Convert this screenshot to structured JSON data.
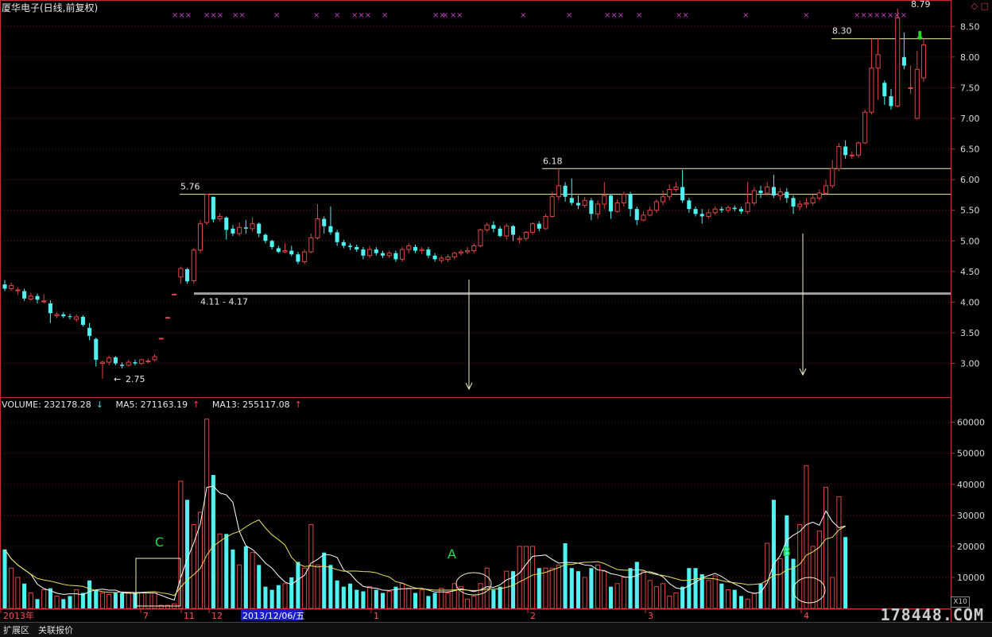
{
  "title": "厦华电子(日线,前复权)",
  "window_icons": "◇ □",
  "colors": {
    "up": "#e04545",
    "down": "#4ff1f1",
    "axis": "#c03030",
    "ma5": "#ffffff",
    "ma13": "#e8e060",
    "grid": "#661818",
    "mark": "#c040c0",
    "hline": "#f0f0b0",
    "support": "#a0a0a0"
  },
  "chart_data": [
    {
      "type": "candlestick",
      "title": "厦华电子(日线,前复权)",
      "ylim": [
        2.45,
        8.75
      ],
      "y_ticks": [
        "8.50",
        "8.00",
        "7.50",
        "7.00",
        "6.50",
        "6.00",
        "5.50",
        "5.00",
        "4.50",
        "4.00",
        "3.50",
        "3.00"
      ],
      "annotations": {
        "low_label": "2.75",
        "range_label": "4.11 - 4.17",
        "level_576": "5.76",
        "level_618": "6.18",
        "level_830": "8.30",
        "high_label": "8.79"
      },
      "reference_levels": [
        5.76,
        6.18,
        8.3,
        4.14
      ],
      "candles": [
        [
          4.29,
          4.22,
          4.36,
          4.18
        ],
        [
          4.22,
          4.27,
          4.32,
          4.18
        ],
        [
          4.2,
          4.2,
          4.24,
          4.12
        ],
        [
          4.18,
          4.06,
          4.22,
          4.02
        ],
        [
          4.05,
          4.1,
          4.15,
          4.02
        ],
        [
          4.1,
          4.04,
          4.14,
          3.98
        ],
        [
          4.02,
          4.02,
          4.13,
          3.98
        ],
        [
          3.98,
          3.82,
          4.03,
          3.66
        ],
        [
          3.78,
          3.8,
          3.84,
          3.74
        ],
        [
          3.8,
          3.77,
          3.84,
          3.74
        ],
        [
          3.77,
          3.76,
          3.81,
          3.72
        ],
        [
          3.72,
          3.76,
          3.8,
          3.68
        ],
        [
          3.76,
          3.63,
          3.79,
          3.6
        ],
        [
          3.58,
          3.45,
          3.66,
          3.38
        ],
        [
          3.4,
          3.06,
          3.42,
          2.95
        ],
        [
          3.0,
          3.02,
          3.05,
          2.75
        ],
        [
          3.02,
          3.09,
          3.13,
          2.97
        ],
        [
          3.1,
          3.0,
          3.12,
          2.97
        ],
        [
          2.98,
          2.96,
          3.02,
          2.92
        ],
        [
          2.97,
          3.02,
          3.06,
          2.95
        ],
        [
          3.02,
          3.0,
          3.06,
          2.97
        ],
        [
          3.0,
          3.06,
          3.08,
          2.98
        ],
        [
          3.04,
          3.04,
          3.08,
          3.0
        ],
        [
          3.06,
          3.11,
          3.15,
          3.03
        ],
        [
          3.41,
          3.41,
          3.42,
          3.4
        ],
        [
          3.75,
          3.75,
          3.76,
          3.74
        ],
        [
          4.13,
          4.13,
          4.14,
          4.12
        ],
        [
          4.41,
          4.55,
          4.58,
          4.3
        ],
        [
          4.54,
          4.34,
          4.56,
          4.3
        ],
        [
          4.35,
          4.85,
          4.88,
          4.3
        ],
        [
          4.85,
          5.28,
          5.34,
          4.8
        ],
        [
          5.3,
          5.76,
          5.76,
          5.26
        ],
        [
          5.72,
          5.35,
          5.72,
          5.3
        ],
        [
          5.36,
          5.4,
          5.45,
          5.32
        ],
        [
          5.38,
          5.18,
          5.4,
          5.02
        ],
        [
          5.2,
          5.12,
          5.26,
          5.08
        ],
        [
          5.12,
          5.22,
          5.3,
          5.08
        ],
        [
          5.22,
          5.2,
          5.34,
          5.12
        ],
        [
          5.2,
          5.28,
          5.38,
          5.16
        ],
        [
          5.28,
          5.12,
          5.3,
          5.06
        ],
        [
          5.1,
          5.0,
          5.12,
          4.96
        ],
        [
          5.0,
          4.9,
          5.02,
          4.86
        ],
        [
          4.88,
          4.82,
          4.92,
          4.8
        ],
        [
          4.82,
          4.84,
          4.96,
          4.8
        ],
        [
          4.84,
          4.78,
          4.92,
          4.75
        ],
        [
          4.78,
          4.66,
          4.82,
          4.62
        ],
        [
          4.66,
          4.82,
          4.86,
          4.62
        ],
        [
          4.82,
          5.05,
          5.12,
          4.8
        ],
        [
          5.05,
          5.36,
          5.6,
          5.02
        ],
        [
          5.36,
          5.24,
          5.4,
          5.12
        ],
        [
          5.24,
          5.14,
          5.56,
          5.1
        ],
        [
          5.14,
          4.98,
          5.18,
          4.92
        ],
        [
          4.98,
          4.92,
          5.02,
          4.88
        ],
        [
          4.92,
          4.9,
          4.96,
          4.85
        ],
        [
          4.9,
          4.86,
          4.94,
          4.82
        ],
        [
          4.86,
          4.76,
          4.9,
          4.7
        ],
        [
          4.76,
          4.86,
          4.92,
          4.72
        ],
        [
          4.86,
          4.8,
          4.9,
          4.76
        ],
        [
          4.8,
          4.76,
          4.84,
          4.72
        ],
        [
          4.76,
          4.8,
          4.84,
          4.72
        ],
        [
          4.8,
          4.7,
          4.84,
          4.66
        ],
        [
          4.7,
          4.86,
          4.9,
          4.66
        ],
        [
          4.86,
          4.92,
          4.96,
          4.8
        ],
        [
          4.9,
          4.84,
          4.94,
          4.8
        ],
        [
          4.84,
          4.86,
          4.9,
          4.78
        ],
        [
          4.86,
          4.76,
          4.9,
          4.72
        ],
        [
          4.76,
          4.7,
          4.8,
          4.66
        ],
        [
          4.68,
          4.72,
          4.76,
          4.64
        ],
        [
          4.7,
          4.74,
          4.78,
          4.66
        ],
        [
          4.74,
          4.8,
          4.82,
          4.7
        ],
        [
          4.8,
          4.82,
          4.86,
          4.76
        ],
        [
          4.82,
          4.84,
          4.9,
          4.78
        ],
        [
          4.84,
          4.92,
          4.96,
          4.8
        ],
        [
          4.92,
          5.18,
          5.2,
          4.9
        ],
        [
          5.18,
          5.26,
          5.3,
          5.14
        ],
        [
          5.26,
          5.2,
          5.32,
          5.14
        ],
        [
          5.2,
          5.08,
          5.24,
          5.06
        ],
        [
          5.08,
          5.24,
          5.28,
          5.02
        ],
        [
          5.24,
          5.1,
          5.26,
          5.0
        ],
        [
          5.02,
          5.04,
          5.08,
          4.96
        ],
        [
          5.04,
          5.14,
          5.16,
          5.0
        ],
        [
          5.14,
          5.28,
          5.3,
          5.1
        ],
        [
          5.28,
          5.2,
          5.32,
          5.16
        ],
        [
          5.2,
          5.4,
          5.44,
          5.18
        ],
        [
          5.4,
          5.72,
          5.8,
          5.38
        ],
        [
          5.72,
          5.9,
          6.18,
          5.66
        ],
        [
          5.9,
          5.72,
          5.96,
          5.64
        ],
        [
          5.7,
          5.62,
          6.02,
          5.58
        ],
        [
          5.62,
          5.58,
          5.74,
          5.52
        ],
        [
          5.58,
          5.66,
          5.72,
          5.54
        ],
        [
          5.66,
          5.44,
          5.7,
          5.34
        ],
        [
          5.44,
          5.6,
          5.66,
          5.36
        ],
        [
          5.6,
          5.74,
          5.96,
          5.52
        ],
        [
          5.74,
          5.48,
          5.76,
          5.36
        ],
        [
          5.48,
          5.62,
          5.68,
          5.46
        ],
        [
          5.62,
          5.76,
          5.8,
          5.56
        ],
        [
          5.76,
          5.52,
          5.8,
          5.4
        ],
        [
          5.52,
          5.34,
          5.56,
          5.26
        ],
        [
          5.34,
          5.42,
          5.48,
          5.32
        ],
        [
          5.42,
          5.5,
          5.56,
          5.4
        ],
        [
          5.5,
          5.64,
          5.68,
          5.46
        ],
        [
          5.64,
          5.72,
          5.82,
          5.58
        ],
        [
          5.72,
          5.84,
          5.92,
          5.66
        ],
        [
          5.84,
          5.88,
          5.96,
          5.8
        ],
        [
          5.88,
          5.66,
          6.16,
          5.62
        ],
        [
          5.66,
          5.52,
          5.7,
          5.46
        ],
        [
          5.52,
          5.44,
          5.56,
          5.4
        ],
        [
          5.44,
          5.4,
          5.52,
          5.28
        ],
        [
          5.4,
          5.46,
          5.52,
          5.36
        ],
        [
          5.46,
          5.52,
          5.56,
          5.42
        ],
        [
          5.52,
          5.5,
          5.56,
          5.46
        ],
        [
          5.5,
          5.54,
          5.58,
          5.46
        ],
        [
          5.54,
          5.52,
          5.58,
          5.48
        ],
        [
          5.52,
          5.48,
          5.56,
          5.44
        ],
        [
          5.48,
          5.62,
          5.96,
          5.44
        ],
        [
          5.62,
          5.82,
          5.88,
          5.58
        ],
        [
          5.82,
          5.78,
          5.9,
          5.7
        ],
        [
          5.78,
          5.88,
          5.96,
          5.74
        ],
        [
          5.88,
          5.74,
          6.08,
          5.7
        ],
        [
          5.74,
          5.8,
          5.86,
          5.66
        ],
        [
          5.8,
          5.7,
          5.86,
          5.62
        ],
        [
          5.7,
          5.56,
          5.74,
          5.44
        ],
        [
          5.56,
          5.6,
          5.66,
          5.5
        ],
        [
          5.6,
          5.62,
          5.7,
          5.54
        ],
        [
          5.62,
          5.7,
          5.76,
          5.58
        ],
        [
          5.7,
          5.78,
          5.84,
          5.66
        ],
        [
          5.78,
          5.9,
          6.0,
          5.76
        ],
        [
          5.9,
          6.18,
          6.32,
          5.86
        ],
        [
          6.18,
          6.54,
          6.6,
          6.14
        ],
        [
          6.54,
          6.4,
          6.64,
          6.34
        ],
        [
          6.4,
          6.4,
          6.46,
          6.34
        ],
        [
          6.4,
          6.6,
          6.62,
          6.36
        ],
        [
          6.6,
          7.1,
          7.14,
          6.58
        ],
        [
          7.1,
          7.82,
          8.3,
          7.06
        ],
        [
          7.82,
          8.04,
          8.3,
          7.3
        ],
        [
          7.58,
          7.36,
          7.62,
          7.22
        ],
        [
          7.36,
          7.2,
          7.48,
          7.14
        ],
        [
          7.2,
          8.64,
          8.79,
          7.18
        ],
        [
          8.0,
          7.86,
          8.4,
          7.8
        ],
        [
          7.5,
          7.5,
          7.86,
          7.4
        ],
        [
          7.0,
          7.8,
          8.1,
          6.98
        ],
        [
          7.66,
          8.2,
          8.3,
          7.6
        ]
      ],
      "marks": [
        "×××",
        "×××",
        "××",
        "×",
        "×",
        "×××",
        "×",
        "××",
        "×××",
        "×",
        "×",
        "×",
        "××",
        "×",
        "××",
        "×",
        "×",
        "××××××××",
        "×"
      ]
    },
    {
      "type": "bar",
      "title": "VOLUME",
      "header": {
        "volume": "VOLUME: 232178.28",
        "ma5": "MA5: 271163.19",
        "ma13": "MA13: 255117.08"
      },
      "ylim": [
        0,
        64000
      ],
      "y_ticks": [
        "60000",
        "50000",
        "40000",
        "30000",
        "20000",
        "10000"
      ],
      "axis_badge": "X10",
      "x_labels": [
        "2013年",
        "7",
        "11",
        "12",
        "2013/12/06/五",
        "1",
        "2",
        "3",
        "4"
      ],
      "annotations": [
        "C",
        "A",
        "B"
      ],
      "volumes": [
        19000,
        13000,
        10000,
        8000,
        5000,
        3000,
        6000,
        6500,
        4000,
        3000,
        4000,
        6000,
        5000,
        9000,
        6000,
        5000,
        4500,
        5000,
        5000,
        5000,
        5000,
        5000,
        5000,
        5000,
        1000,
        1000,
        1500,
        41000,
        35000,
        27000,
        31000,
        61000,
        43000,
        24000,
        24000,
        19000,
        14000,
        20000,
        18000,
        14000,
        7000,
        6000,
        7500,
        8000,
        10000,
        15000,
        13000,
        27000,
        14000,
        18000,
        14000,
        9000,
        7000,
        8000,
        6000,
        5500,
        7000,
        6000,
        5000,
        5500,
        7000,
        8000,
        6500,
        5000,
        6000,
        4000,
        5000,
        6500,
        5000,
        8000,
        7000,
        3000,
        4000,
        8000,
        13000,
        6000,
        7000,
        12000,
        12000,
        20000,
        20000,
        20000,
        13000,
        13000,
        13000,
        14000,
        21000,
        13000,
        12000,
        10000,
        13000,
        14000,
        12000,
        7000,
        8000,
        10000,
        13000,
        15000,
        12000,
        9000,
        7000,
        8000,
        4000,
        5000,
        7000,
        13000,
        13000,
        11000,
        9000,
        10500,
        8000,
        6000,
        6000,
        4000,
        3000,
        5000,
        8000,
        21000,
        35000,
        16000,
        30000,
        16000,
        27000,
        46000,
        20000,
        25000,
        39000,
        10000,
        36000,
        23000
      ]
    }
  ]
}
